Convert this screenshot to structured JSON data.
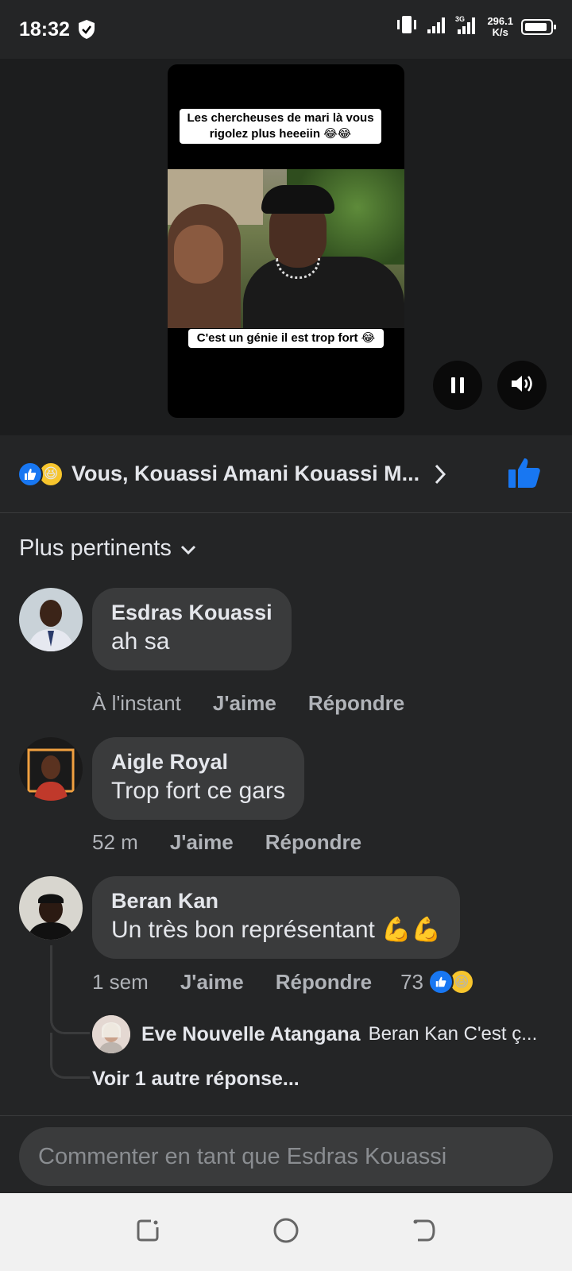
{
  "status_bar": {
    "time": "18:32",
    "network_speed_value": "296.1",
    "network_speed_unit": "K/s",
    "network_type": "3G"
  },
  "video": {
    "caption_top": "Les chercheuses de mari là vous rigolez plus heeeiin 😂😂",
    "caption_bottom": "C'est un génie il est trop fort 😂",
    "pause_icon": "pause-icon",
    "volume_icon": "volume-icon"
  },
  "reactions": {
    "summary": "Vous, Kouassi Amani Kouassi M...",
    "icons": [
      "like-icon",
      "haha-icon"
    ]
  },
  "sort": {
    "label": "Plus pertinents"
  },
  "comments": [
    {
      "author": "Esdras Kouassi",
      "text": "ah sa",
      "time": "À l'instant",
      "like_label": "J'aime",
      "reply_label": "Répondre"
    },
    {
      "author": "Aigle Royal",
      "text": "Trop fort ce gars",
      "time": "52 m",
      "like_label": "J'aime",
      "reply_label": "Répondre"
    },
    {
      "author": "Beran Kan",
      "text": "Un très bon représentant 💪💪",
      "time": "1 sem",
      "like_label": "J'aime",
      "reply_label": "Répondre",
      "reaction_count": "73"
    }
  ],
  "reply": {
    "author": "Eve Nouvelle Atangana",
    "text": "Beran Kan C'est ç..."
  },
  "more_replies": "Voir 1 autre réponse...",
  "compose": {
    "placeholder": "Commenter en tant que Esdras Kouassi"
  },
  "nav": {
    "icons": [
      "recents-icon",
      "home-icon",
      "back-icon"
    ]
  },
  "colors": {
    "background": "#242526",
    "bubble": "#3a3b3c",
    "accent": "#1877f2",
    "secondary_text": "#b0b3b8"
  }
}
